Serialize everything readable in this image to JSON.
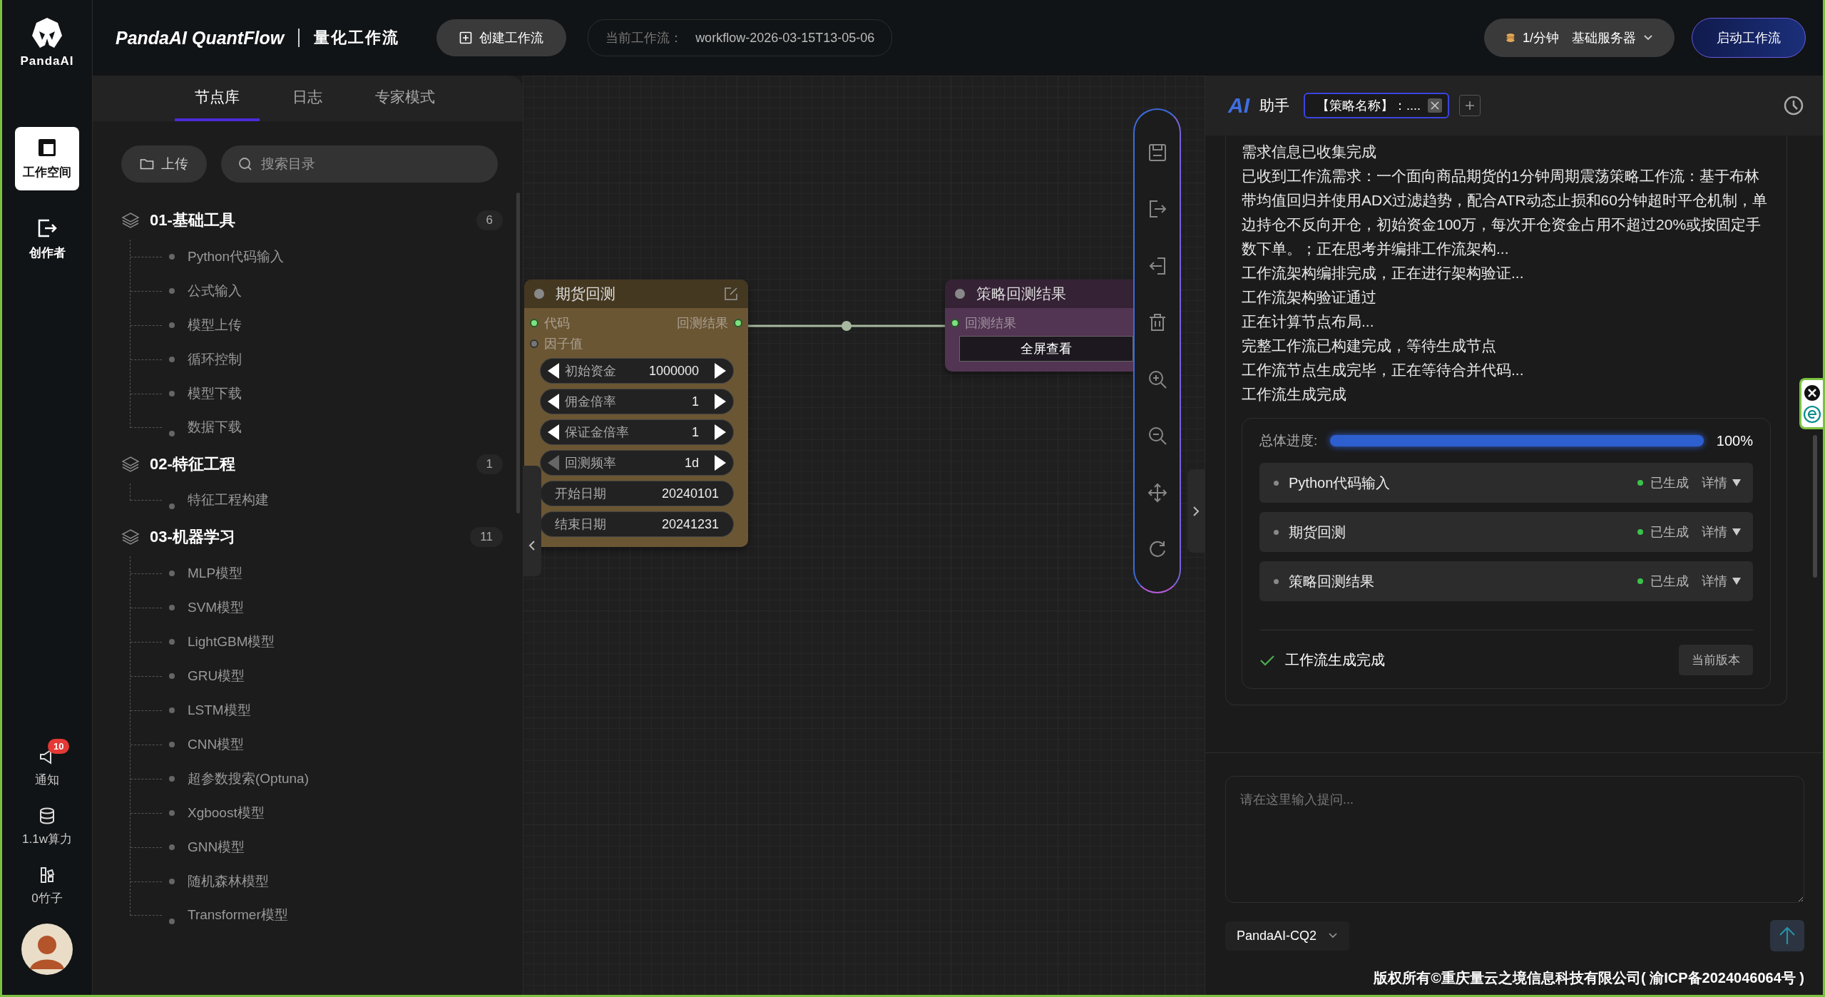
{
  "brand": {
    "logo_text": "PandaAI",
    "title": "PandaAI QuantFlow",
    "subtitle": "量化工作流"
  },
  "header": {
    "create_button": "创建工作流",
    "current_label": "当前工作流：",
    "current_workflow": "workflow-2026-03-15T13-05-06",
    "rate": "1/分钟",
    "server": "基础服务器",
    "start_button": "启动工作流"
  },
  "nav": {
    "top": [
      {
        "label": "工作空间",
        "selected": true
      },
      {
        "label": "创作者",
        "selected": false
      }
    ],
    "bottom": [
      {
        "label": "通知",
        "badge": "10"
      },
      {
        "label": "1.1w算力"
      },
      {
        "label": "0竹子"
      }
    ]
  },
  "panel": {
    "tabs": [
      {
        "label": "节点库",
        "selected": true
      },
      {
        "label": "日志",
        "selected": false
      },
      {
        "label": "专家模式",
        "selected": false
      }
    ],
    "upload_button": "上传",
    "search": {
      "placeholder": "搜索目录"
    },
    "groups": [
      {
        "label": "01-基础工具",
        "count": "6",
        "children": [
          {
            "label": "Python代码输入"
          },
          {
            "label": "公式输入"
          },
          {
            "label": "模型上传"
          },
          {
            "label": "循环控制"
          },
          {
            "label": "模型下载"
          },
          {
            "label": "数据下载"
          }
        ]
      },
      {
        "label": "02-特征工程",
        "count": "1",
        "children": [
          {
            "label": "特征工程构建"
          }
        ]
      },
      {
        "label": "03-机器学习",
        "count": "11",
        "children": [
          {
            "label": "MLP模型"
          },
          {
            "label": "SVM模型"
          },
          {
            "label": "LightGBM模型"
          },
          {
            "label": "GRU模型"
          },
          {
            "label": "LSTM模型"
          },
          {
            "label": "CNN模型"
          },
          {
            "label": "超参数搜索(Optuna)"
          },
          {
            "label": "Xgboost模型"
          },
          {
            "label": "GNN模型"
          },
          {
            "label": "随机森林模型"
          },
          {
            "label": "Transformer模型"
          }
        ]
      }
    ]
  },
  "canvas": {
    "nodes": [
      {
        "title": "期货回测",
        "color": "#6b5634",
        "inputs": [
          {
            "label": "代码",
            "connected": true
          },
          {
            "label": "因子值",
            "connected": false
          }
        ],
        "output": {
          "label": "回测结果",
          "connected": true
        },
        "widgets": [
          {
            "kind": "stepper",
            "label": "初始资金",
            "value": "1000000",
            "prev_enabled": true
          },
          {
            "kind": "stepper",
            "label": "佣金倍率",
            "value": "1",
            "prev_enabled": true
          },
          {
            "kind": "stepper",
            "label": "保证金倍率",
            "value": "1",
            "prev_enabled": true
          },
          {
            "kind": "stepper",
            "label": "回测频率",
            "value": "1d",
            "prev_enabled": false
          },
          {
            "kind": "text",
            "label": "开始日期",
            "value": "20240101"
          },
          {
            "kind": "text",
            "label": "结束日期",
            "value": "20241231"
          }
        ]
      },
      {
        "title": "策略回测结果",
        "color": "#523552",
        "inputs": [
          {
            "label": "回测结果",
            "connected": true
          }
        ],
        "button": "全屏查看"
      }
    ]
  },
  "assistant": {
    "logo": "AI",
    "title": "助手",
    "session_tab": "【策略名称】：....",
    "messages": [
      "需求信息已收集完成",
      "已收到工作流需求：一个面向商品期货的1分钟周期震荡策略工作流：基于布林带均值回归并使用ADX过滤趋势，配合ATR动态止损和60分钟超时平仓机制，单边持仓不反向开仓，初始资金100万，每次开仓资金占用不超过20%或按固定手数下单。；正在思考并编排工作流架构...",
      "工作流架构编排完成，正在进行架构验证...",
      "工作流架构验证通过",
      "正在计算节点布局...",
      "完整工作流已构建完成，等待生成节点",
      "工作流节点生成完毕，正在等待合并代码...",
      "工作流生成完成"
    ],
    "progress": {
      "label": "总体进度:",
      "level": 1,
      "reading": "100%"
    },
    "steps": [
      {
        "name": "Python代码输入",
        "status": "已生成",
        "detail": "详情"
      },
      {
        "name": "期货回测",
        "status": "已生成",
        "detail": "详情"
      },
      {
        "name": "策略回测结果",
        "status": "已生成",
        "detail": "详情"
      }
    ],
    "complete": "工作流生成完成",
    "version_button": "当前版本",
    "input": {
      "placeholder": "请在这里输入提问..."
    },
    "model": "PandaAI-CQ2"
  },
  "footer": "版权所有©重庆量云之境信息科技有限公司( 渝ICP备2024046064号 )"
}
